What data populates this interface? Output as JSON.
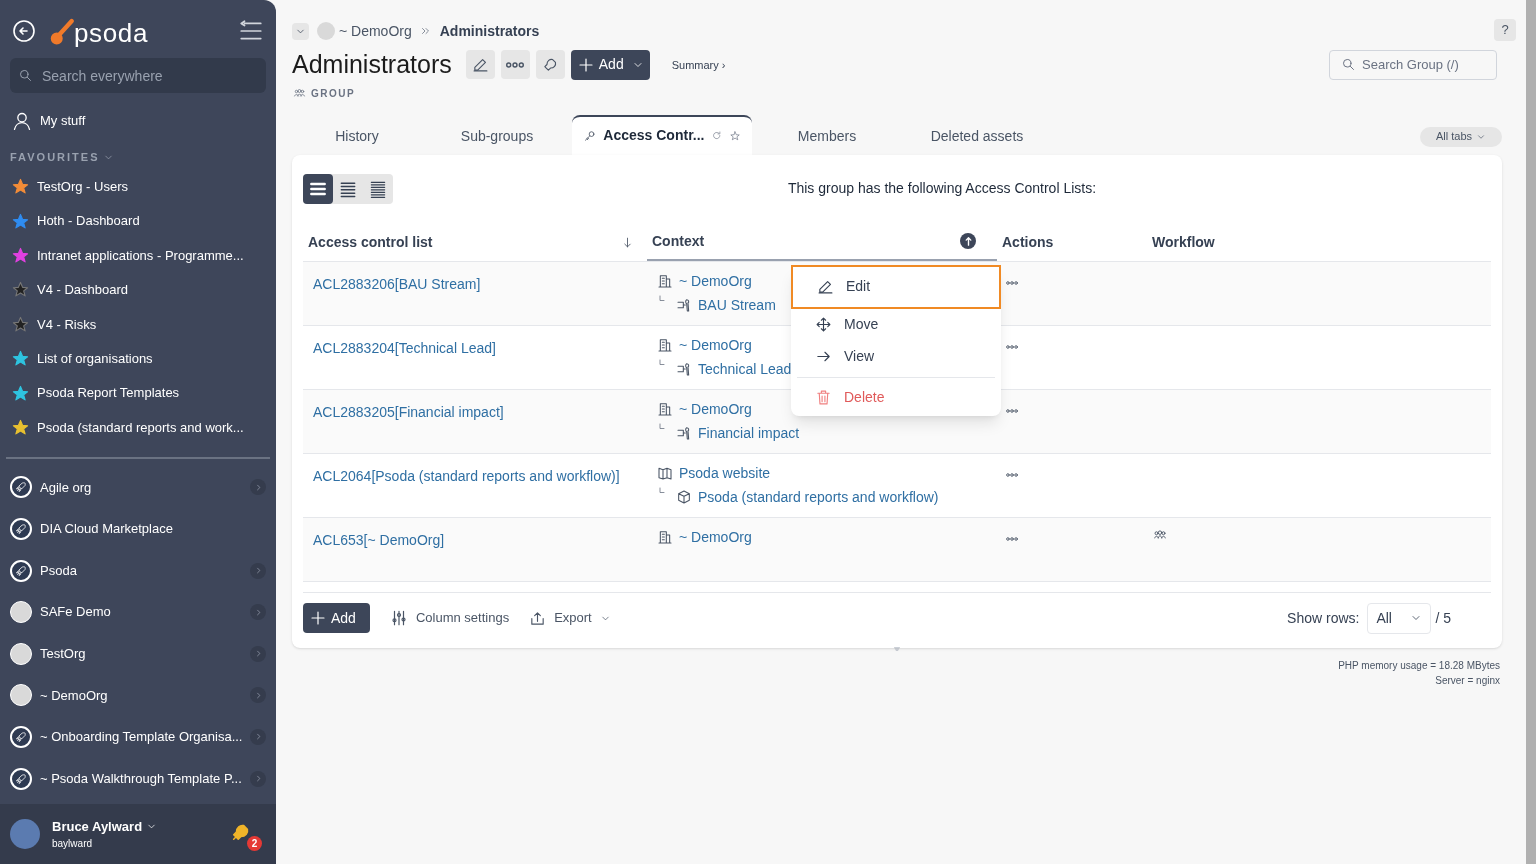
{
  "sidebar": {
    "logo": "psoda",
    "search_placeholder": "Search everywhere",
    "my_stuff": "My stuff",
    "favourites_heading": "FAVOURITES",
    "favourites": [
      {
        "label": "TestOrg - Users",
        "color": "#f28c38"
      },
      {
        "label": "Hoth - Dashboard",
        "color": "#2f8cf0"
      },
      {
        "label": "Intranet applications - Programme...",
        "color": "#e040e0"
      },
      {
        "label": "V4 - Dashboard",
        "color": "#222222"
      },
      {
        "label": "V4 - Risks",
        "color": "#222222"
      },
      {
        "label": "List of organisations",
        "color": "#2ec4e0"
      },
      {
        "label": "Psoda Report Templates",
        "color": "#2ec4e0"
      },
      {
        "label": "Psoda (standard reports and work...",
        "color": "#e8c030"
      }
    ],
    "organisations": [
      {
        "label": "Agile org",
        "kind": "rocket",
        "expandable": true
      },
      {
        "label": "DIA Cloud Marketplace",
        "kind": "rocket",
        "expandable": false
      },
      {
        "label": "Psoda",
        "kind": "rocket",
        "expandable": true
      },
      {
        "label": "SAFe Demo",
        "kind": "image",
        "expandable": true
      },
      {
        "label": "TestOrg",
        "kind": "image",
        "expandable": true
      },
      {
        "label": "~ DemoOrg",
        "kind": "image",
        "expandable": true
      },
      {
        "label": "~ Onboarding Template Organisa...",
        "kind": "rocket",
        "expandable": true
      },
      {
        "label": "~ Psoda Walkthrough Template P...",
        "kind": "rocket",
        "expandable": true
      }
    ],
    "user": {
      "name": "Bruce Aylward",
      "login": "baylward",
      "notifications": "2"
    }
  },
  "breadcrumb": {
    "org": "~ DemoOrg",
    "current": "Administrators"
  },
  "header": {
    "title": "Administrators",
    "type": "GROUP",
    "add_button": "Add",
    "summary_link": "Summary ›",
    "help": "?",
    "search_placeholder": "Search Group (/)"
  },
  "tabs": [
    {
      "label": "History",
      "selected": false
    },
    {
      "label": "Sub-groups",
      "selected": false
    },
    {
      "label": "Access Contr...",
      "selected": true
    },
    {
      "label": "Members",
      "selected": false
    },
    {
      "label": "Deleted assets",
      "selected": false
    }
  ],
  "all_tabs": "All tabs",
  "view_modes": [
    {
      "selected": true
    },
    {
      "selected": false
    },
    {
      "selected": false
    }
  ],
  "intro": "This group has the following Access Control Lists:",
  "table": {
    "columns": [
      "Access control list",
      "Context",
      "Actions",
      "Workflow"
    ],
    "rows": [
      {
        "acl": "ACL2883206[BAU Stream]",
        "context": {
          "kind": "org",
          "label": "~ DemoOrg",
          "children": [
            {
              "kind": "role",
              "label": "BAU Stream"
            }
          ]
        },
        "workflow": false
      },
      {
        "acl": "ACL2883204[Technical Lead]",
        "context": {
          "kind": "org",
          "label": "~ DemoOrg",
          "children": [
            {
              "kind": "role",
              "label": "Technical Lead"
            }
          ]
        },
        "workflow": false
      },
      {
        "acl": "ACL2883205[Financial impact]",
        "context": {
          "kind": "org",
          "label": "~ DemoOrg",
          "children": [
            {
              "kind": "role",
              "label": "Financial impact"
            }
          ]
        },
        "workflow": false
      },
      {
        "acl": "ACL2064[Psoda (standard reports and workflow)]",
        "context": {
          "kind": "website",
          "label": "Psoda website",
          "children": [
            {
              "kind": "package",
              "label": "Psoda (standard reports and workflow)"
            }
          ]
        },
        "workflow": false
      },
      {
        "acl": "ACL653[~ DemoOrg]",
        "context": {
          "kind": "org",
          "label": "~ DemoOrg"
        },
        "workflow": true
      }
    ]
  },
  "context_menu": [
    {
      "kind": "edit",
      "label": "Edit",
      "selected": true
    },
    {
      "kind": "move",
      "label": "Move",
      "selected": false
    },
    {
      "kind": "view",
      "label": "View",
      "selected": false
    },
    {
      "kind": "delete",
      "label": "Delete",
      "selected": false
    }
  ],
  "footer": {
    "add_button": "Add",
    "column_settings": "Column settings",
    "export": "Export",
    "show_rows_label": "Show rows:",
    "show_rows_value": "All",
    "total": "/ 5"
  },
  "server_info": [
    "PHP memory usage = 18.28 MBytes",
    "Server = nginx"
  ]
}
